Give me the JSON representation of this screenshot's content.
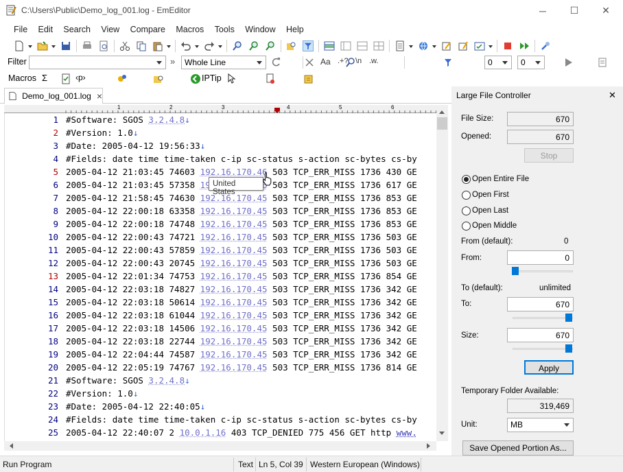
{
  "window": {
    "title": "C:\\Users\\Public\\Demo_log_001.log - EmEditor",
    "min_glyph": "─",
    "max_glyph": "☐",
    "close_glyph": "✕"
  },
  "menu": [
    "File",
    "Edit",
    "Search",
    "View",
    "Compare",
    "Macros",
    "Tools",
    "Window",
    "Help"
  ],
  "filter_bar": {
    "label": "Filter",
    "value": "",
    "mode": "Whole Line",
    "num1": "0",
    "num2": "0",
    "more_glyph": "»"
  },
  "macros_bar": {
    "label": "Macros",
    "sigma": "Σ",
    "tag_glyph": "‹p›",
    "iptip": "IPTip"
  },
  "tab": {
    "name": "Demo_log_001.log",
    "close_glyph": "×"
  },
  "ruler_marks": [
    "1",
    "2",
    "3",
    "4",
    "5",
    "6"
  ],
  "editor_lines": [
    {
      "n": "1",
      "text": "#Software: SGOS ",
      "url": "3.2.4.8",
      "tail": "",
      "arrow": "↓"
    },
    {
      "n": "2",
      "text": "#Version: 1.0",
      "arrow": "↓"
    },
    {
      "n": "3",
      "text": "#Date: 2005-04-12 19:56:33",
      "arrow": "↓"
    },
    {
      "n": "4",
      "text": "#Fields: date time time-taken c-ip sc-status s-action sc-bytes cs-by"
    },
    {
      "n": "5",
      "text": "2005-04-12 21:03:45 74603 ",
      "url": "192.16.170.46",
      "tail": " 503 TCP_ERR_MISS 1736 430 GE"
    },
    {
      "n": "6",
      "text": "2005-04-12 21:03:45 57358 ",
      "url": "192.16.170.46",
      "tail": " 503 TCP_ERR_MISS 1736 617 GE"
    },
    {
      "n": "7",
      "text": "2005-04-12 21:58:45 74630 ",
      "url": "192.16.170.45",
      "tail": " 503 TCP_ERR_MISS 1736 853 GE"
    },
    {
      "n": "8",
      "text": "2005-04-12 22:00:18 63358 ",
      "url": "192.16.170.45",
      "tail": " 503 TCP_ERR_MISS 1736 853 GE"
    },
    {
      "n": "9",
      "text": "2005-04-12 22:00:18 74748 ",
      "url": "192.16.170.45",
      "tail": " 503 TCP_ERR_MISS 1736 853 GE"
    },
    {
      "n": "10",
      "text": "2005-04-12 22:00:43 74721 ",
      "url": "192.16.170.45",
      "tail": " 503 TCP_ERR_MISS 1736 503 GE"
    },
    {
      "n": "11",
      "text": "2005-04-12 22:00:43 57859 ",
      "url": "192.16.170.45",
      "tail": " 503 TCP_ERR_MISS 1736 503 GE"
    },
    {
      "n": "12",
      "text": "2005-04-12 22:00:43 20745 ",
      "url": "192.16.170.45",
      "tail": " 503 TCP_ERR_MISS 1736 503 GE"
    },
    {
      "n": "13",
      "text": "2005-04-12 22:01:34 74753 ",
      "url": "192.16.170.45",
      "tail": " 503 TCP_ERR_MISS 1736 854 GE"
    },
    {
      "n": "14",
      "text": "2005-04-12 22:03:18 74827 ",
      "url": "192.16.170.45",
      "tail": " 503 TCP_ERR_MISS 1736 342 GE"
    },
    {
      "n": "15",
      "text": "2005-04-12 22:03:18 50614 ",
      "url": "192.16.170.45",
      "tail": " 503 TCP_ERR_MISS 1736 342 GE"
    },
    {
      "n": "16",
      "text": "2005-04-12 22:03:18 61044 ",
      "url": "192.16.170.45",
      "tail": " 503 TCP_ERR_MISS 1736 342 GE"
    },
    {
      "n": "17",
      "text": "2005-04-12 22:03:18 14506 ",
      "url": "192.16.170.45",
      "tail": " 503 TCP_ERR_MISS 1736 342 GE"
    },
    {
      "n": "18",
      "text": "2005-04-12 22:03:18 22744 ",
      "url": "192.16.170.45",
      "tail": " 503 TCP_ERR_MISS 1736 342 GE"
    },
    {
      "n": "19",
      "text": "2005-04-12 22:04:44 74587 ",
      "url": "192.16.170.45",
      "tail": " 503 TCP_ERR_MISS 1736 342 GE"
    },
    {
      "n": "20",
      "text": "2005-04-12 22:05:19 74767 ",
      "url": "192.16.170.45",
      "tail": " 503 TCP_ERR_MISS 1736 814 GE"
    },
    {
      "n": "21",
      "text": "#Software: SGOS ",
      "url": "3.2.4.8",
      "tail": "",
      "arrow": "↓"
    },
    {
      "n": "22",
      "text": "#Version: 1.0",
      "arrow": "↓"
    },
    {
      "n": "23",
      "text": "#Date: 2005-04-12 22:40:05",
      "arrow": "↓"
    },
    {
      "n": "24",
      "text": "#Fields: date time time-taken c-ip sc-status s-action sc-bytes cs-by"
    },
    {
      "n": "25",
      "text": "2005-04-12 22:40:07 2 ",
      "url": "10.0.1.16",
      "tail": " 403 TCP_DENIED 775 456 GET http ",
      "url2": "www."
    }
  ],
  "tooltip": "United States",
  "panel": {
    "title": "Large File Controller",
    "close_glyph": "✕",
    "file_size_label": "File Size:",
    "file_size": "670",
    "opened_label": "Opened:",
    "opened": "670",
    "stop": "Stop",
    "open_modes": [
      "Open Entire File",
      "Open First",
      "Open Last",
      "Open Middle"
    ],
    "selected_mode": "Open Entire File",
    "from_default_label": "From (default):",
    "from_default": "0",
    "from_label": "From:",
    "from": "0",
    "to_default_label": "To (default):",
    "to_default": "unlimited",
    "to_label": "To:",
    "to": "670",
    "size_label": "Size:",
    "size": "670",
    "apply": "Apply",
    "temp_label": "Temporary Folder Available:",
    "temp_value": "319,469",
    "unit_label": "Unit:",
    "unit": "MB",
    "save_button": "Save Opened Portion As..."
  },
  "status": {
    "left": "Run Program",
    "mode": "Text",
    "position": "Ln 5, Col 39",
    "encoding": "Western European (Windows)"
  }
}
